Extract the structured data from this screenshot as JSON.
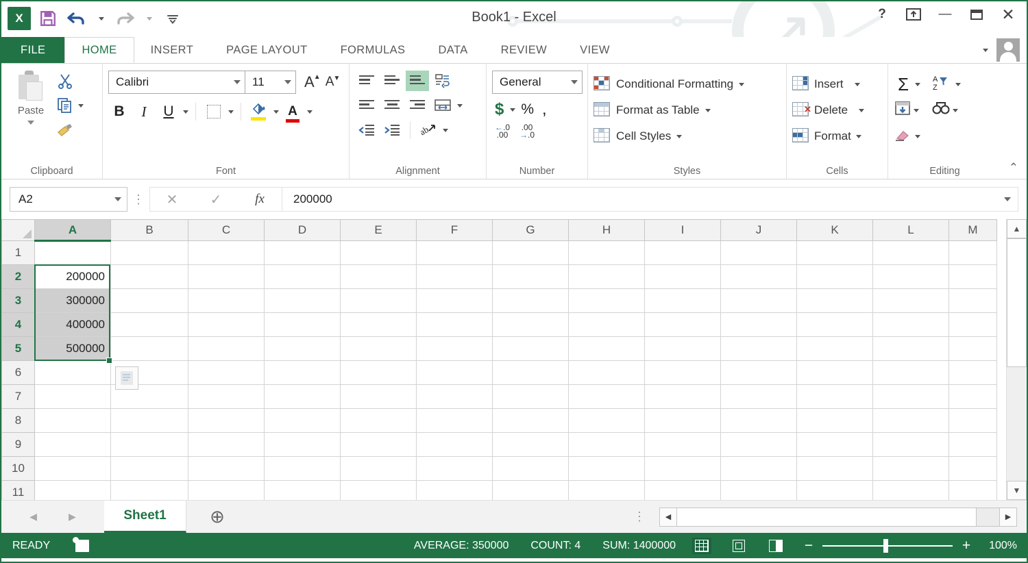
{
  "app": {
    "title": "Book1 - Excel",
    "logo_text": "X"
  },
  "quick_access": {
    "save_label": "save-icon",
    "undo_label": "undo-icon",
    "redo_label": "redo-icon",
    "customize_label": "customize-qat-icon"
  },
  "window_controls": {
    "help": "?",
    "ribbon_display": "⛶",
    "minimize": "—",
    "maximize": "▢",
    "close": "✕"
  },
  "ribbon_tabs": [
    {
      "label": "FILE"
    },
    {
      "label": "HOME"
    },
    {
      "label": "INSERT"
    },
    {
      "label": "PAGE LAYOUT"
    },
    {
      "label": "FORMULAS"
    },
    {
      "label": "DATA"
    },
    {
      "label": "REVIEW"
    },
    {
      "label": "VIEW"
    }
  ],
  "ribbon": {
    "clipboard": {
      "group_label": "Clipboard",
      "paste_label": "Paste",
      "cut_label": "cut-icon",
      "copy_label": "copy-icon",
      "format_painter_label": "format-painter-icon"
    },
    "font": {
      "group_label": "Font",
      "font_name": "Calibri",
      "font_size": "11",
      "grow_font": "A",
      "shrink_font": "A",
      "bold": "B",
      "italic": "I",
      "underline": "U",
      "borders_label": "borders-icon",
      "fill_color_label": "fill-color-icon",
      "font_color": "A"
    },
    "alignment": {
      "group_label": "Alignment",
      "top_align": "top-align-icon",
      "middle_align": "middle-align-icon",
      "bottom_align": "bottom-align-icon",
      "wrap_text": "wrap-text-icon",
      "align_left": "align-left-icon",
      "align_center": "align-center-icon",
      "align_right": "align-right-icon",
      "merge_center": "merge-and-center-icon",
      "decrease_indent": "decrease-indent-icon",
      "increase_indent": "increase-indent-icon",
      "orientation": "orientation-icon"
    },
    "number": {
      "group_label": "Number",
      "format": "General",
      "currency": "$",
      "percent": "%",
      "comma": ",",
      "increase_decimal": "increase-decimal-icon",
      "decrease_decimal": "decrease-decimal-icon"
    },
    "styles": {
      "group_label": "Styles",
      "conditional_formatting": "Conditional Formatting",
      "format_as_table": "Format as Table",
      "cell_styles": "Cell Styles"
    },
    "cells": {
      "group_label": "Cells",
      "insert": "Insert",
      "delete": "Delete",
      "format": "Format"
    },
    "editing": {
      "group_label": "Editing",
      "autosum": "Σ",
      "fill": "fill-icon",
      "clear": "clear-icon",
      "sort_filter": "sort-and-filter-icon",
      "find_select": "find-and-select-icon"
    },
    "collapse_label": "collapse-ribbon-icon"
  },
  "formula_bar": {
    "name_box_value": "A2",
    "cancel_label": "✕",
    "enter_label": "✓",
    "fx_label": "fx",
    "formula_value": "200000"
  },
  "grid": {
    "columns": [
      "A",
      "B",
      "C",
      "D",
      "E",
      "F",
      "G",
      "H",
      "I",
      "J",
      "K",
      "L",
      "M"
    ],
    "selected_column": "A",
    "rows": [
      {
        "num": "1",
        "selected": false,
        "cells": [
          "",
          "",
          "",
          "",
          "",
          "",
          "",
          "",
          "",
          "",
          "",
          "",
          ""
        ]
      },
      {
        "num": "2",
        "selected": true,
        "cells": [
          "200000",
          "",
          "",
          "",
          "",
          "",
          "",
          "",
          "",
          "",
          "",
          "",
          ""
        ]
      },
      {
        "num": "3",
        "selected": true,
        "cells": [
          "300000",
          "",
          "",
          "",
          "",
          "",
          "",
          "",
          "",
          "",
          "",
          "",
          ""
        ]
      },
      {
        "num": "4",
        "selected": true,
        "cells": [
          "400000",
          "",
          "",
          "",
          "",
          "",
          "",
          "",
          "",
          "",
          "",
          "",
          ""
        ]
      },
      {
        "num": "5",
        "selected": true,
        "cells": [
          "500000",
          "",
          "",
          "",
          "",
          "",
          "",
          "",
          "",
          "",
          "",
          "",
          ""
        ]
      },
      {
        "num": "6",
        "selected": false,
        "cells": [
          "",
          "",
          "",
          "",
          "",
          "",
          "",
          "",
          "",
          "",
          "",
          "",
          ""
        ]
      },
      {
        "num": "7",
        "selected": false,
        "cells": [
          "",
          "",
          "",
          "",
          "",
          "",
          "",
          "",
          "",
          "",
          "",
          "",
          ""
        ]
      },
      {
        "num": "8",
        "selected": false,
        "cells": [
          "",
          "",
          "",
          "",
          "",
          "",
          "",
          "",
          "",
          "",
          "",
          "",
          ""
        ]
      },
      {
        "num": "9",
        "selected": false,
        "cells": [
          "",
          "",
          "",
          "",
          "",
          "",
          "",
          "",
          "",
          "",
          "",
          "",
          ""
        ]
      },
      {
        "num": "10",
        "selected": false,
        "cells": [
          "",
          "",
          "",
          "",
          "",
          "",
          "",
          "",
          "",
          "",
          "",
          "",
          ""
        ]
      },
      {
        "num": "11",
        "selected": false,
        "cells": [
          "",
          "",
          "",
          "",
          "",
          "",
          "",
          "",
          "",
          "",
          "",
          "",
          ""
        ]
      }
    ],
    "selection_range": "A2:A5",
    "active_cell": "A2",
    "autofill_options_label": "autofill-options-icon"
  },
  "sheet_tabs": {
    "prev_label": "◀",
    "next_label": "▶",
    "sheets": [
      {
        "name": "Sheet1",
        "active": true
      }
    ],
    "add_sheet_label": "⊕",
    "overflow_label": "⋮"
  },
  "status_bar": {
    "mode": "READY",
    "macro_record_label": "record-macro-icon",
    "average": "AVERAGE: 350000",
    "count": "COUNT: 4",
    "sum": "SUM: 1400000",
    "view_normal_label": "normal-view-icon",
    "view_page_layout_label": "page-layout-view-icon",
    "view_page_break_label": "page-break-preview-icon",
    "zoom_out": "−",
    "zoom_in": "+",
    "zoom_level": "100%"
  },
  "colors": {
    "excel_green": "#217346",
    "selection_border": "#217346",
    "selection_fill": "#cfcfcf",
    "header_gray": "#f2f2f2",
    "header_selected": "#d3d3d3"
  }
}
